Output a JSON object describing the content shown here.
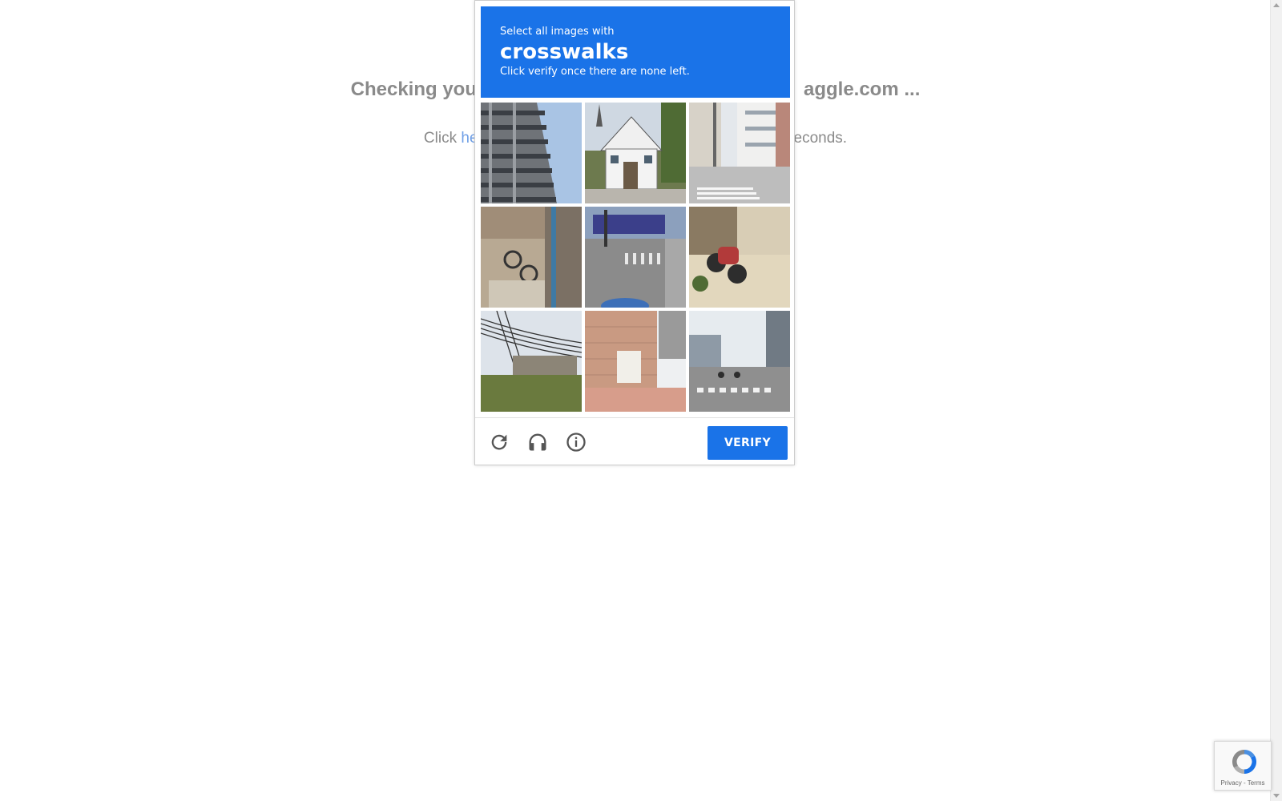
{
  "background": {
    "heading_left": "Checking you",
    "heading_right": "aggle.com ...",
    "text_prefix": "Click ",
    "text_link": "he",
    "text_suffix": "econds."
  },
  "captcha": {
    "instruction": "Select all images with",
    "target": "crosswalks",
    "note": "Click verify once there are none left.",
    "tiles": [
      {
        "scene": "high-rise apartment building"
      },
      {
        "scene": "white house with church steeple"
      },
      {
        "scene": "street with crosswalk and buildings"
      },
      {
        "scene": "old building with bicycle"
      },
      {
        "scene": "intersection with crosswalk"
      },
      {
        "scene": "motorcycles parked on sidewalk"
      },
      {
        "scene": "building with power lines"
      },
      {
        "scene": "brick apartment building stairs"
      },
      {
        "scene": "city street with crosswalk"
      }
    ],
    "verify_label": "VERIFY",
    "icons": [
      "reload-icon",
      "headphones-icon",
      "info-icon"
    ]
  },
  "badge": {
    "terms": "Privacy - Terms"
  },
  "colors": {
    "accent": "#1a73e8",
    "bg_text": "#8a8a8a",
    "link": "#6f9fe6"
  }
}
